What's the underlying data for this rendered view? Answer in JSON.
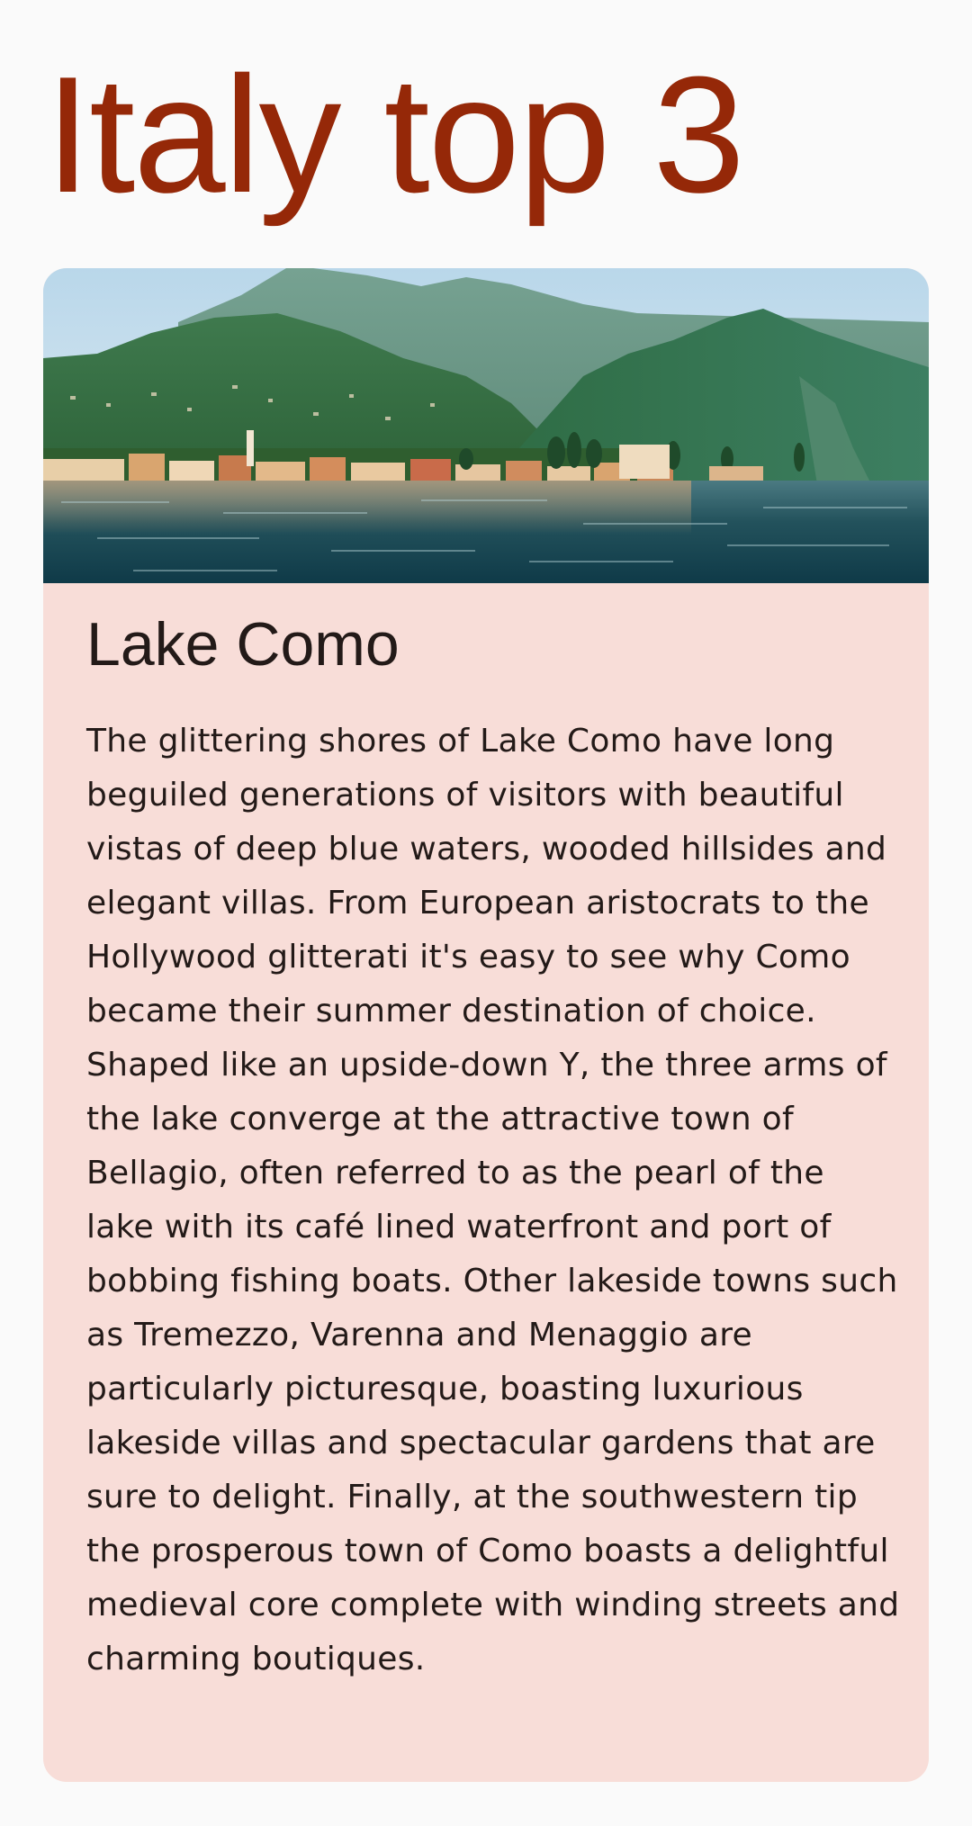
{
  "header": {
    "title": "Italy top 3"
  },
  "card": {
    "image_name": "lake-como-photo",
    "title": "Lake Como",
    "body": "The glittering shores of Lake Como have long beguiled generations of visitors with beautiful vistas of deep blue waters, wooded hillsides and elegant villas. From European aristocrats to the Hollywood glitterati it's easy to see why Como became their summer destination of choice. Shaped like an upside-down Y, the three arms of the lake converge at the attractive town of Bellagio, often referred to as the pearl of the lake with its café lined waterfront and port of bobbing fishing boats. Other lakeside towns such as Tremezzo, Varenna and Menaggio are particularly picturesque, boasting luxurious lakeside villas and spectacular gardens that are sure to delight. Finally, at the southwestern tip the prosperous town of Como boasts a delightful medieval core complete with winding streets and charming boutiques."
  },
  "colors": {
    "title": "#952808",
    "card_background": "#f8ddd8",
    "page_background": "#fafafa",
    "text": "#231a18"
  }
}
